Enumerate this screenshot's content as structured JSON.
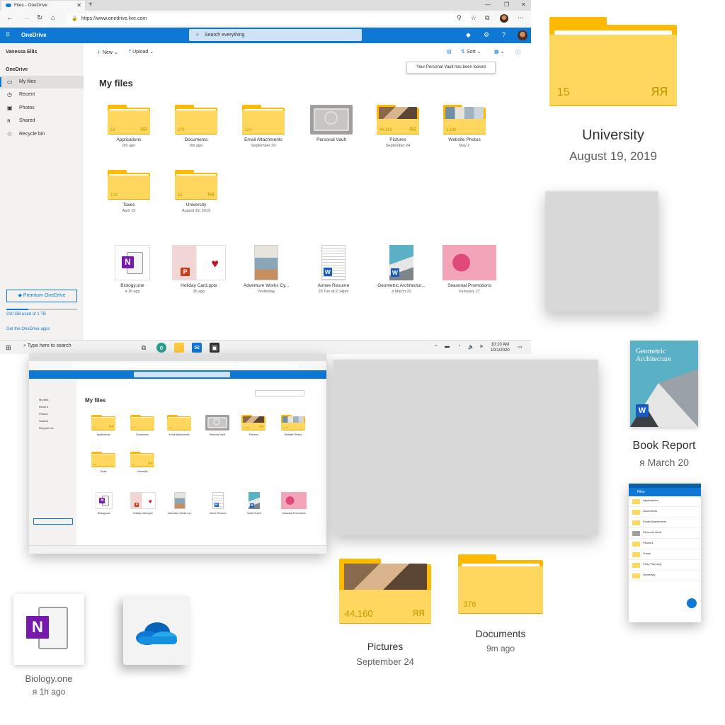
{
  "browser": {
    "tab_title": "Files - OneDrive",
    "new_tab": "+",
    "url": "https://www.onedrive.live.com",
    "window_controls": [
      "—",
      "❐",
      "✕"
    ]
  },
  "appbar": {
    "brand": "OneDrive",
    "search_placeholder": "Search everything"
  },
  "sidebar": {
    "user": "Vanessa Ellis",
    "section": "OneDrive",
    "items": [
      {
        "label": "My files",
        "icon": "folder-icon"
      },
      {
        "label": "Recent",
        "icon": "clock-icon"
      },
      {
        "label": "Photos",
        "icon": "photo-icon"
      },
      {
        "label": "Shared",
        "icon": "people-icon"
      },
      {
        "label": "Recycle bin",
        "icon": "recycle-icon"
      }
    ],
    "premium_label": "Premium OneDrive",
    "storage_text": "310 GB used of 1 TB",
    "storage_fraction": 0.31,
    "get_apps": "Get the OneDrive apps"
  },
  "commandbar": {
    "new_label": "New",
    "upload_label": "Upload",
    "sort_label": "Sort"
  },
  "tooltip": "Your Personal Vault has been locked",
  "page_title": "My files",
  "folders": [
    {
      "name": "Applications",
      "sub": "9m ago",
      "count": "53",
      "shared": true,
      "photo": ""
    },
    {
      "name": "Documents",
      "sub": "9m ago",
      "count": "376",
      "shared": false,
      "photo": ""
    },
    {
      "name": "Email Attachments",
      "sub": "September 29",
      "count": "120",
      "shared": false,
      "photo": ""
    },
    {
      "name": "Personal Vault",
      "sub": "",
      "count": "",
      "shared": false,
      "photo": "vault"
    },
    {
      "name": "Pictures",
      "sub": "September 24",
      "count": "44,160",
      "shared": true,
      "photo": "people"
    },
    {
      "name": "Website Photos",
      "sub": "May 2",
      "count": "3,198",
      "shared": false,
      "photo": "shelf"
    },
    {
      "name": "Taxes",
      "sub": "April 15",
      "count": "124",
      "shared": false,
      "photo": ""
    },
    {
      "name": "University",
      "sub": "August 19, 2019",
      "count": "15",
      "shared": true,
      "photo": ""
    }
  ],
  "files": [
    {
      "name": "Biology.one",
      "sub": "1h ago",
      "shared": true,
      "kind": "onenote"
    },
    {
      "name": "Holiday Card.pptx",
      "sub": "2h ago",
      "shared": false,
      "kind": "ppt-card"
    },
    {
      "name": "Adventure Works Cy...",
      "sub": "Yesterday",
      "shared": false,
      "kind": "magazine"
    },
    {
      "name": "Aimee Resume",
      "sub": "29 Tue at 2:14pm",
      "shared": false,
      "kind": "resume"
    },
    {
      "name": "Geometric Architectur...",
      "sub": "March 20",
      "shared": true,
      "kind": "geometric"
    },
    {
      "name": "Seasonal Promotions",
      "sub": "February 27",
      "shared": false,
      "kind": "promo"
    }
  ],
  "taskbar": {
    "search": "Type here to search",
    "time": "10:10 AM",
    "date": "10/1/2020"
  },
  "mini": {
    "sidebar_items": [
      "My files",
      "Recent",
      "Photos",
      "Shared",
      "Recycle bin"
    ],
    "file_names": [
      "Biology.one",
      "Holiday Card.pptx",
      "Adventure Works Cy...",
      "Aimee Resume",
      "Book Report",
      "Seasonal Promotions"
    ]
  },
  "cards": {
    "university": {
      "name": "University",
      "date": "August 19, 2019",
      "count": "15"
    },
    "book_report": {
      "name": "Book Report",
      "date": "March 20",
      "cover_title": "Geometric Architecture"
    },
    "pictures": {
      "name": "Pictures",
      "date": "September 24",
      "count": "44,160"
    },
    "documents": {
      "name": "Documents",
      "date": "9m ago",
      "count": "376"
    },
    "biology": {
      "name": "Biology.one",
      "date": "1h ago"
    }
  },
  "phone": {
    "title": "Files",
    "rows": [
      "Applications",
      "Documents",
      "Email Attachments",
      "Personal Vault",
      "Pictures",
      "Travel",
      "Party Planning",
      "University"
    ]
  },
  "colors": {
    "accent": "#0f78d4",
    "folder_front": "#ffd75e",
    "folder_back": "#ffb900"
  }
}
